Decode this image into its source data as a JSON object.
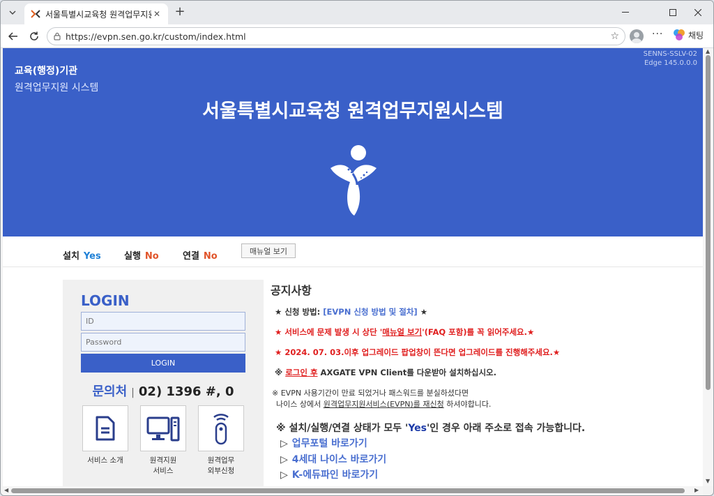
{
  "browser": {
    "tab_title": "서울특별시교육청 원격업무지원시",
    "url": "https://evpn.sen.go.kr/custom/index.html",
    "copilot_label": "채팅"
  },
  "header": {
    "org_line1": "교육(행정)기관",
    "org_line2": "원격업무지원 시스템",
    "version_line1": "SENNS-SSLV-02",
    "version_line2": "Edge 145.0.0.0",
    "title": "서울특별시교육청 원격업무지원시스템"
  },
  "status": {
    "install_label": "설치",
    "install_value": "Yes",
    "run_label": "실행",
    "run_value": "No",
    "connect_label": "연결",
    "connect_value": "No",
    "manual_button": "매뉴얼 보기"
  },
  "login": {
    "heading": "LOGIN",
    "id_placeholder": "ID",
    "password_placeholder": "Password",
    "button": "LOGIN",
    "contact_label": "문의처",
    "contact_sep": "|",
    "contact_phone": "02) 1396 #, 0"
  },
  "services": [
    {
      "label1": "서비스 소개",
      "label2": ""
    },
    {
      "label1": "원격지원",
      "label2": "서비스"
    },
    {
      "label1": "원격업무",
      "label2": "외부신청"
    }
  ],
  "notice": {
    "title": "공지사항",
    "l1_prefix": "★ 신청 방법:",
    "l1_link": "[EVPN 신청 방법 및 절차]",
    "l1_suffix": "★",
    "l2_prefix": "★ 서비스에 문제 발생 시 상단 '",
    "l2_underlined": "매뉴얼 보기",
    "l2_suffix": "'(FAQ 포함)를 꼭 읽어주세요.★",
    "l3": "★ 2024. 07. 03.이후 업그레이드 팝업창이 뜬다면 업그레이드를 진행해주세요.★",
    "l4_prefix": "※",
    "l4_underlined": "로그인 후",
    "l4_suffix": "AXGATE VPN Client를 다운받아 설치하십시오.",
    "l5": "※ EVPN 사용기간이 만료 되었거나 패스워드를 분실하셨다면",
    "l6_prefix": "나이스 상에서",
    "l6_underlined": "원격업무지원서비스(EVPN)를 재신청",
    "l6_suffix": "하셔야합니다.",
    "access_prefix": "※ 설치/실행/연결 상태가 모두 '",
    "access_yes": "Yes",
    "access_suffix": "'인 경우 아래 주소로 접속 가능합니다.",
    "links": [
      {
        "arrow": "▷",
        "text": "업무포털 바로가기"
      },
      {
        "arrow": "▷",
        "text": "4세대 나이스 바로가기"
      },
      {
        "arrow": "▷",
        "text": "K-에듀파인 바로가기"
      }
    ]
  },
  "colors": {
    "brand_blue": "#3a60c8",
    "yes": "#1f80d6",
    "no": "#e0542a",
    "notice_red": "#e02020"
  }
}
